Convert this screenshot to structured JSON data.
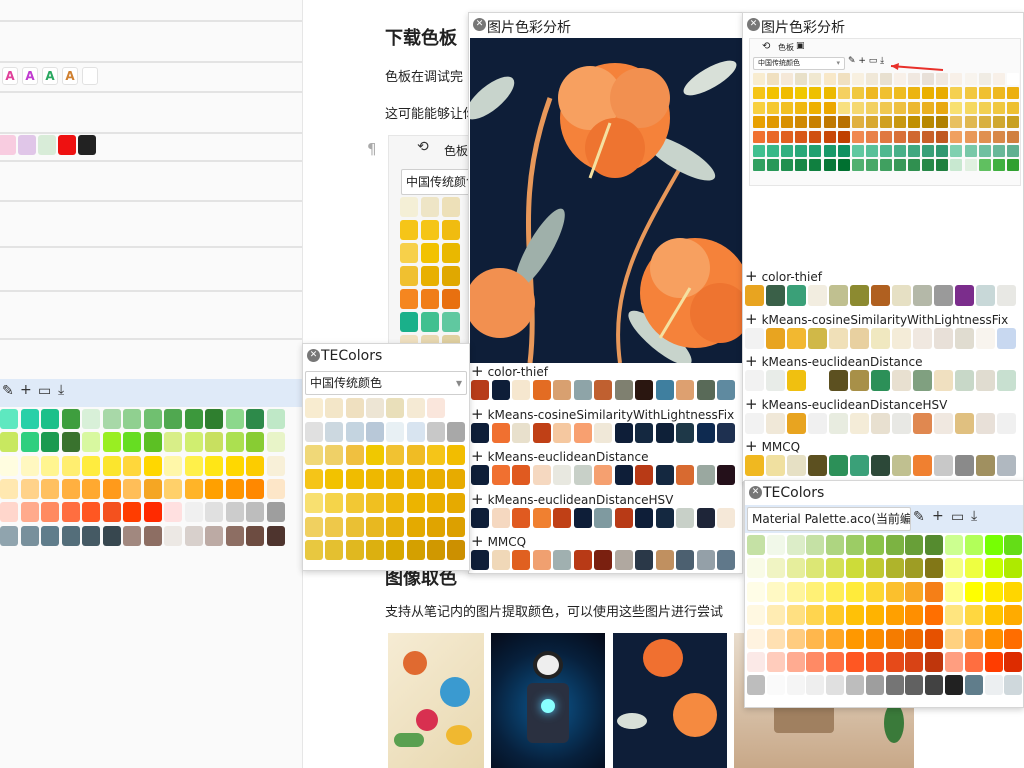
{
  "doc": {
    "heading": "下载色板",
    "para1": "色板在调试完",
    "para2": "这可能能够让你",
    "partial_heading": "图像取色",
    "para3": "支持从笔记内的图片提取颜色，可以使用这些图片进行尝试",
    "paragraph_mark": "¶",
    "tab_label": "色板",
    "select_value": "中国传统颜色"
  },
  "left": {
    "a_marks": [
      {
        "t": "A",
        "c": "#e0409a"
      },
      {
        "t": "A",
        "c": "#c03ad0"
      },
      {
        "t": "A",
        "c": "#2aa860"
      },
      {
        "t": "A",
        "c": "#d08030"
      },
      {
        "t": "",
        "c": "#ccc"
      }
    ],
    "swatches": [
      "#f8cce0",
      "#e0c6e8",
      "#d8ecd8",
      "#ee1111",
      "#222222"
    ],
    "grid": [
      [
        "#5ee8c0",
        "#28d0a8",
        "#1cc08a",
        "#3e9e3e",
        "#d8f0d8",
        "#a8d8a8",
        "#90d090",
        "#70c070",
        "#50a850",
        "#3c983c",
        "#2f7f2f",
        "#8cd88c",
        "#2d8a4a",
        "#bfe8c7"
      ],
      [
        "#c8e860",
        "#2fcf7f",
        "#1a9a50",
        "#39722e",
        "#d8f8a0",
        "#99ee22",
        "#66dd22",
        "#5cc024",
        "#d8ee88",
        "#d0ee70",
        "#c8e060",
        "#ace050",
        "#88cc33",
        "#e8f4c8"
      ],
      [
        "#fffde0",
        "#fff8c0",
        "#fff590",
        "#ffee70",
        "#ffec3f",
        "#fbe52d",
        "#ffd73b",
        "#ffd700",
        "#fff7a8",
        "#fff04a",
        "#ffe616",
        "#ffd800",
        "#fccc00",
        "#f8f0d8"
      ],
      [
        "#ffe8b0",
        "#ffd28a",
        "#ffc060",
        "#ffb040",
        "#ffa930",
        "#ff9a1b",
        "#ffbe58",
        "#f5a623",
        "#ffd06a",
        "#ffb428",
        "#ffa000",
        "#ff9500",
        "#ff8800",
        "#fde6c8"
      ],
      [
        "#ffd6cc",
        "#ffaa8c",
        "#ff8a60",
        "#ff6e40",
        "#ff5722",
        "#f4511e",
        "#ff3d00",
        "#ff2a00",
        "#ffe0e0",
        "#f0f0f0",
        "#e0e0e0",
        "#cccccc",
        "#bdbdbd",
        "#9e9e9e"
      ],
      [
        "#90a4ae",
        "#78909c",
        "#607d8b",
        "#546e7a",
        "#455a64",
        "#37474f",
        "#a1887f",
        "#8d6e63",
        "#ece8e4",
        "#d8d0cc",
        "#bcaaa4",
        "#8d6e63",
        "#6d4c41",
        "#4e342e"
      ]
    ]
  },
  "docpanel": {
    "grid": [
      [
        "#f4efd6",
        "#eee5c6",
        "#ede0b8"
      ],
      [
        "#f5c518",
        "#f5c518",
        "#f0bc10"
      ],
      [
        "#f7d04a",
        "#f2c200",
        "#e9b800"
      ],
      [
        "#f0c030",
        "#e8b000",
        "#e0a800"
      ],
      [
        "#f5861f",
        "#f07d18",
        "#e87010"
      ],
      [
        "#1ab08a",
        "#40c090",
        "#60c8a0"
      ],
      [
        "#f0e0c0",
        "#e8d8b0",
        "#e0d0a0"
      ]
    ]
  },
  "tecolors_small": {
    "title": "TEColors",
    "select": "中国传统颜色",
    "grid": [
      [
        "#f8ecd0",
        "#f3e6c8",
        "#efe0c0",
        "#ede5d4",
        "#e9dfba",
        "#f5ead4",
        "#fae6dc",
        "#ffffff"
      ],
      [
        "#e0e0e0",
        "#ccd8e0",
        "#c4d4e0",
        "#b8c8d8",
        "#e8f0f4",
        "#d8e4f0",
        "#c8c8c8",
        "#a8a8a8"
      ],
      [
        "#f0d878",
        "#efd067",
        "#f0c040",
        "#f0c800",
        "#f1c232",
        "#f0bc24",
        "#f5c518",
        "#f2bd00"
      ],
      [
        "#f5c518",
        "#f2c200",
        "#f0bc00",
        "#eeb800",
        "#ecb400",
        "#ebb100",
        "#e9ae00",
        "#e7ab00"
      ],
      [
        "#f8e070",
        "#f5d44a",
        "#f2c834",
        "#f0c020",
        "#eeb80c",
        "#ecb400",
        "#eaaf00",
        "#e6aa00"
      ],
      [
        "#f0d060",
        "#eec84a",
        "#eac034",
        "#e8b820",
        "#e6b00c",
        "#e4aa00",
        "#e0a400",
        "#dca000"
      ],
      [
        "#e8c840",
        "#e4c030",
        "#e0b820",
        "#dcb010",
        "#d8a800",
        "#d4a000",
        "#d09800",
        "#cc9000"
      ]
    ]
  },
  "panel_mid": {
    "title": "图片色彩分析",
    "sections": [
      {
        "name": "color-thief",
        "colors": [
          "#b73c1a",
          "#0e1e38",
          "#f6e7cf",
          "#e36c23",
          "#d8a070",
          "#8ea4a8",
          "#c06030",
          "#7f8070",
          "#2a1610",
          "#3f7f9f",
          "#dda070",
          "#596a58",
          "#5f8aa0"
        ]
      },
      {
        "name": "kMeans-cosineSimilarityWithLightnessFix",
        "colors": [
          "#0e1e38",
          "#f07030",
          "#e8e0cc",
          "#c04016",
          "#f5c8a0",
          "#f8a070",
          "#f0e8d8",
          "#0e1e38",
          "#142840",
          "#0e2038",
          "#1e3848",
          "#0e2a50",
          "#1e3050"
        ]
      },
      {
        "name": "kMeans-euclideanDistance",
        "colors": [
          "#0e1e38",
          "#f07030",
          "#e05a20",
          "#f5d8c0",
          "#e8e8e0",
          "#c8d0c8",
          "#f5a070",
          "#0e1e38",
          "#b83a16",
          "#142840",
          "#d86a30",
          "#9aa8a0",
          "#24101a"
        ]
      },
      {
        "name": "kMeans-euclideanDistanceHSV",
        "colors": [
          "#0e1e38",
          "#f5d8c0",
          "#e05a20",
          "#f08030",
          "#c04016",
          "#0e1e38",
          "#7f9aa0",
          "#b83a16",
          "#0e1e38",
          "#142840",
          "#c8d0c8",
          "#1e2538",
          "#f5e8d8"
        ]
      },
      {
        "name": "MMCQ",
        "colors": [
          "#0e1e38",
          "#f0d8b8",
          "#e06020",
          "#f0a070",
          "#a0b0b0",
          "#b83a16",
          "#7a2010",
          "#b0a8a0",
          "#2a3848",
          "#c09060",
          "#4c6070",
          "#94a0a8",
          "#60788a"
        ]
      }
    ]
  },
  "panel_right": {
    "title": "图片色彩分析",
    "tab": "色板",
    "select": "中国传统颜色",
    "mini_grid": [
      [
        "#f8ecd0",
        "#f0e0c0",
        "#f5e8d8",
        "#e8e0c8",
        "#f0e8d0",
        "#f8e8c8",
        "#f0e0c0",
        "#f8f0e0",
        "#f0e8d8",
        "#e8e0d0",
        "#f8f0e8",
        "#f0e8e0",
        "#e8e0d8",
        "#f0e8e0",
        "#f8f0e8",
        "#f8f4ee",
        "#f0ece4",
        "#f8f0e8",
        "#ffffff"
      ],
      [
        "#f5c518",
        "#f2c200",
        "#f0bc00",
        "#f0c800",
        "#eec000",
        "#ecba00",
        "#f5d060",
        "#f0c840",
        "#eeb820",
        "#f0c030",
        "#eebc20",
        "#ecb410",
        "#eab000",
        "#e8ac00",
        "#f5d050",
        "#f2c840",
        "#f0c030",
        "#eeb820",
        "#ecb010"
      ],
      [
        "#f8d040",
        "#f5c830",
        "#f2c020",
        "#f0b810",
        "#eeb000",
        "#eca800",
        "#f8e080",
        "#f5d870",
        "#f2d060",
        "#f0c850",
        "#eec040",
        "#ecb830",
        "#eab020",
        "#e8a810",
        "#f8e070",
        "#f5d860",
        "#f2d050",
        "#f0c840",
        "#eec030"
      ],
      [
        "#e8a000",
        "#e09800",
        "#d89000",
        "#d08800",
        "#c88000",
        "#c07800",
        "#b87000",
        "#e0b040",
        "#d8a830",
        "#d0a020",
        "#c89810",
        "#c09000",
        "#b88800",
        "#b08000",
        "#e8c060",
        "#e0b850",
        "#d8b040",
        "#d0a830",
        "#c8a020"
      ],
      [
        "#f07030",
        "#e86828",
        "#e06020",
        "#d85818",
        "#d05010",
        "#c84808",
        "#c04000",
        "#f08850",
        "#e88048",
        "#e07840",
        "#d87038",
        "#d06830",
        "#c86028",
        "#c05820",
        "#f0a060",
        "#e89858",
        "#e09050",
        "#d88848",
        "#d08040"
      ],
      [
        "#40c090",
        "#38b888",
        "#30b080",
        "#28a878",
        "#20a070",
        "#189868",
        "#109060",
        "#60c8a0",
        "#58c098",
        "#50b890",
        "#48b088",
        "#40a880",
        "#38a078",
        "#309870",
        "#80d0b0",
        "#78c8a8",
        "#70c0a0",
        "#68b898",
        "#60b090"
      ],
      [
        "#30a060",
        "#289858",
        "#209050",
        "#188848",
        "#108040",
        "#087838",
        "#007030",
        "#50b070",
        "#48a868",
        "#40a060",
        "#389858",
        "#309050",
        "#288848",
        "#208040",
        "#c8e8d0",
        "#e0f0e0",
        "#60c060",
        "#40b040",
        "#30a030"
      ]
    ],
    "sections": [
      {
        "name": "color-thief",
        "colors": [
          "#e8a420",
          "#3a6048",
          "#3aa078",
          "#f2ede0",
          "#c0c090",
          "#8c8a30",
          "#b06020",
          "#e6e0c4",
          "#b4b8a8",
          "#9a9a9a",
          "#7b2d8c",
          "#c8d8d8",
          "#e8e8e4"
        ]
      },
      {
        "name": "kMeans-cosineSimilarityWithLightnessFix",
        "colors": [
          "#f2f2f2",
          "#e8a420",
          "#f2b830",
          "#d0b848",
          "#f0e0b8",
          "#e8d0a0",
          "#f0e8c0",
          "#f4ecd8",
          "#f0e8e0",
          "#e8e0d8",
          "#e0dcd0",
          "#f8f4ee",
          "#c8d8f0"
        ]
      },
      {
        "name": "kMeans-euclideanDistance",
        "colors": [
          "#f2f2f2",
          "#e8ece8",
          "#f0c010",
          "#ffffff",
          "#5c5020",
          "#a89048",
          "#2c9058",
          "#e8e0d0",
          "#80a080",
          "#f0e0c0",
          "#c8d8c8",
          "#e0dcd0",
          "#c8e0d0"
        ]
      },
      {
        "name": "kMeans-euclideanDistanceHSV",
        "colors": [
          "#f2f2f2",
          "#f0e8d8",
          "#e8a420",
          "#f0f0f0",
          "#e8ece0",
          "#f4ecd8",
          "#e8e0d0",
          "#e8e8e4",
          "#e08850",
          "#f0e8e0",
          "#e0c080",
          "#e8e0d8",
          "#f0f0f0"
        ]
      },
      {
        "name": "MMCQ",
        "colors": [
          "#f0b820",
          "#f0e0a0",
          "#e6e0c4",
          "#5c5020",
          "#2c9058",
          "#3aa078",
          "#2c4838",
          "#c0c090",
          "#f08030",
          "#c8c8c8",
          "#8a8a8a",
          "#a09060",
          "#b0b8c0"
        ]
      }
    ]
  },
  "tecolors_right": {
    "title": "TEColors",
    "select": "Material Palette.aco(当前编",
    "grid": [
      [
        "#c5e1a5",
        "#f1f8e9",
        "#dcedc8",
        "#c5e1a5",
        "#aed581",
        "#9ccc65",
        "#8bc34a",
        "#7cb342",
        "#689f38",
        "#558b2f",
        "#ccff90",
        "#b2ff59",
        "#76ff03",
        "#64dd17"
      ],
      [
        "#f9fbe7",
        "#f0f4c3",
        "#e6ee9c",
        "#dce775",
        "#d4e157",
        "#cddc39",
        "#c0ca33",
        "#afb42b",
        "#9e9d24",
        "#827717",
        "#f4ff81",
        "#eeff41",
        "#c6ff00",
        "#aeea00"
      ],
      [
        "#fffde7",
        "#fff9c4",
        "#fff59d",
        "#fff176",
        "#ffee58",
        "#ffeb3b",
        "#fdd835",
        "#fbc02d",
        "#f9a825",
        "#f57f17",
        "#ffff8d",
        "#ffff00",
        "#ffea00",
        "#ffd600"
      ],
      [
        "#fff8e1",
        "#ffecb3",
        "#ffe082",
        "#ffd54f",
        "#ffca28",
        "#ffc107",
        "#ffb300",
        "#ffa000",
        "#ff8f00",
        "#ff6f00",
        "#ffe57f",
        "#ffd740",
        "#ffc400",
        "#ffab00"
      ],
      [
        "#fff3e0",
        "#ffe0b2",
        "#ffcc80",
        "#ffb74d",
        "#ffa726",
        "#ff9800",
        "#fb8c00",
        "#f57c00",
        "#ef6c00",
        "#e65100",
        "#ffd180",
        "#ffab40",
        "#ff9100",
        "#ff6d00"
      ],
      [
        "#fbe9e7",
        "#ffccbc",
        "#ffab91",
        "#ff8a65",
        "#ff7043",
        "#ff5722",
        "#f4511e",
        "#e64a19",
        "#d84315",
        "#bf360c",
        "#ff9e80",
        "#ff6e40",
        "#ff3d00",
        "#dd2c00"
      ],
      [
        "#bdbdbd",
        "#fafafa",
        "#f5f5f5",
        "#eeeeee",
        "#e0e0e0",
        "#bdbdbd",
        "#9e9e9e",
        "#757575",
        "#616161",
        "#424242",
        "#212121",
        "#607d8b",
        "#eceff1",
        "#cfd8dc"
      ]
    ]
  }
}
